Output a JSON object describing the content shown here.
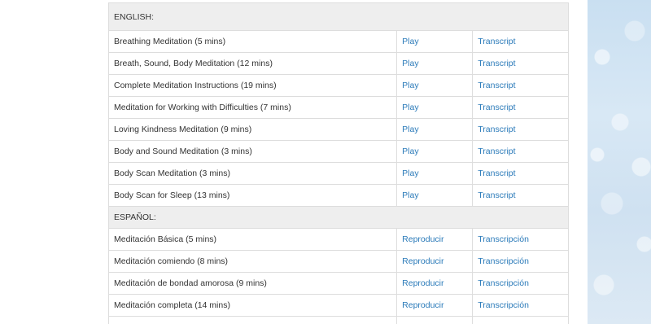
{
  "sections": [
    {
      "heading": "ENGLISH:",
      "rows": [
        {
          "title": "Breathing Meditation (5 mins)",
          "play": "Play",
          "transcript": "Transcript"
        },
        {
          "title": "Breath, Sound, Body Meditation (12 mins)",
          "play": "Play",
          "transcript": "Transcript"
        },
        {
          "title": "Complete Meditation Instructions (19 mins)",
          "play": "Play",
          "transcript": "Transcript"
        },
        {
          "title": "Meditation for Working with Difficulties (7 mins)",
          "play": "Play",
          "transcript": "Transcript"
        },
        {
          "title": "Loving Kindness Meditation (9 mins)",
          "play": "Play",
          "transcript": "Transcript"
        },
        {
          "title": "Body and Sound Meditation (3 mins)",
          "play": "Play",
          "transcript": "Transcript"
        },
        {
          "title": "Body Scan Meditation (3 mins)",
          "play": "Play",
          "transcript": "Transcript"
        },
        {
          "title": "Body Scan for Sleep (13 mins)",
          "play": "Play",
          "transcript": "Transcript"
        }
      ]
    },
    {
      "heading": "ESPAÑOL:",
      "rows": [
        {
          "title": "Meditación Básica (5 mins)",
          "play": "Reproducir",
          "transcript": "Transcripción"
        },
        {
          "title": "Meditación comiendo (8 mins)",
          "play": "Reproducir",
          "transcript": "Transcripción"
        },
        {
          "title": "Meditación de bondad amorosa (9 mins)",
          "play": "Reproducir",
          "transcript": "Transcripción"
        },
        {
          "title": "Meditación completa (14 mins)",
          "play": "Reproducir",
          "transcript": "Transcripción"
        }
      ]
    }
  ]
}
